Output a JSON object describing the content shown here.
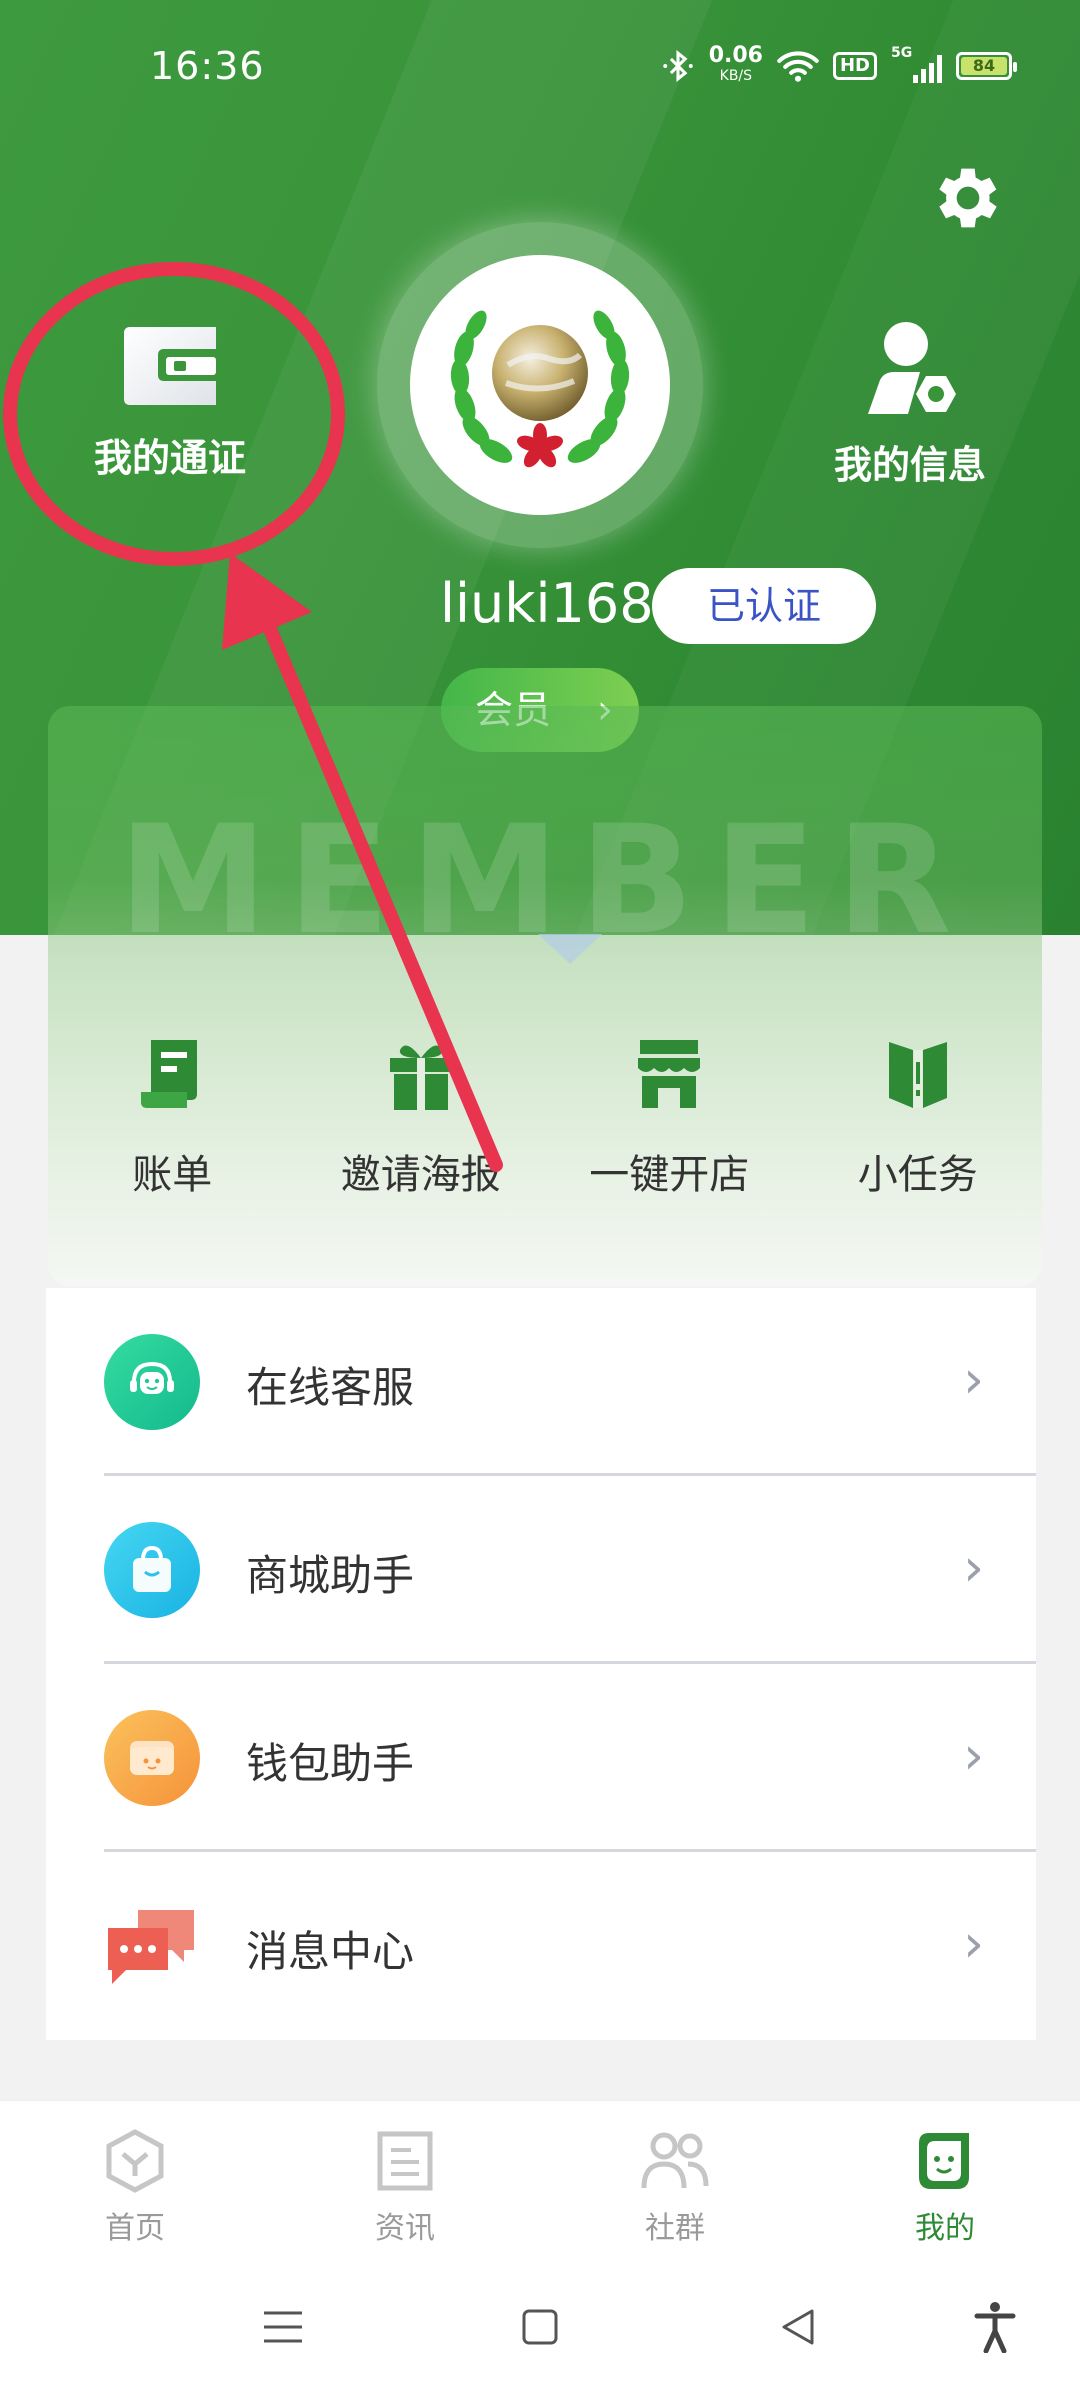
{
  "status_bar": {
    "time": "16:36",
    "net_speed": "0.06",
    "net_unit": "KB/S",
    "hd": "HD",
    "signal": "5G",
    "battery": "84"
  },
  "header": {
    "my_pass_label": "我的通证",
    "my_info_label": "我的信息",
    "username": "liuki168",
    "verified_badge": "已认证",
    "member_button": "会员",
    "member_chevron": "›"
  },
  "member_card": {
    "watermark": "MEMBER"
  },
  "quick_actions": [
    {
      "label": "账单",
      "icon": "bill-icon"
    },
    {
      "label": "邀请海报",
      "icon": "gift-icon"
    },
    {
      "label": "一键开店",
      "icon": "store-icon"
    },
    {
      "label": "小任务",
      "icon": "task-icon"
    }
  ],
  "list_items": [
    {
      "label": "在线客服",
      "icon": "customer-service-icon",
      "color": "#1ec99a"
    },
    {
      "label": "商城助手",
      "icon": "shopping-bag-icon",
      "color": "#2cc3ea"
    },
    {
      "label": "钱包助手",
      "icon": "wallet-icon",
      "color": "#f7a94a"
    },
    {
      "label": "消息中心",
      "icon": "message-icon",
      "color": "#f07466"
    }
  ],
  "list_chevron": "›",
  "bottom_nav": [
    {
      "label": "首页",
      "icon": "home-icon",
      "active": false
    },
    {
      "label": "资讯",
      "icon": "news-icon",
      "active": false
    },
    {
      "label": "社群",
      "icon": "community-icon",
      "active": false
    },
    {
      "label": "我的",
      "icon": "profile-icon",
      "active": true
    }
  ],
  "colors": {
    "header_green": "#3a953a",
    "active_green": "#2f8a35",
    "annotation_red": "#e8344e",
    "verified_blue": "#3a54c6"
  }
}
